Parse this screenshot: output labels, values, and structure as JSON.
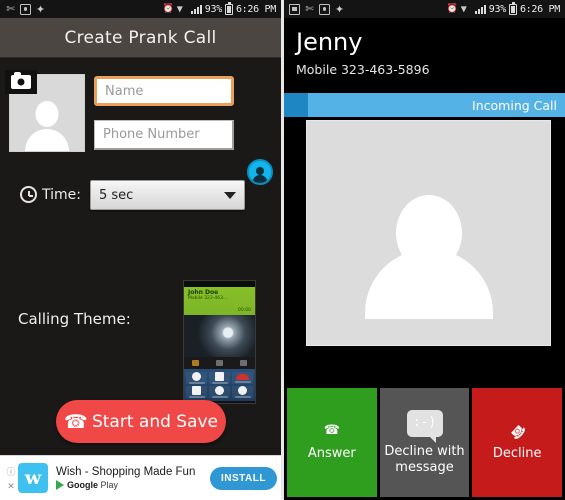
{
  "left": {
    "statusbar": {
      "icons": [
        "scissors-icon",
        "camera-icon",
        "dropbox-icon"
      ],
      "alarm_icon": "alarm-icon",
      "wifi_icon": "wifi-icon",
      "signal_icon": "signal-bars-icon",
      "battery_percent": "93%",
      "battery_icon": "battery-icon",
      "clock": "6:26 PM"
    },
    "title": "Create Prank Call",
    "avatar": {
      "placeholder_icon": "person-silhouette-icon",
      "camera_badge_icon": "camera-icon"
    },
    "fields": {
      "name_placeholder": "Name",
      "name_value": "",
      "phone_placeholder": "Phone Number",
      "phone_value": ""
    },
    "contact_picker_icon": "contact-person-icon",
    "time": {
      "icon": "alarm-clock-icon",
      "label": "Time:",
      "selected": "5 sec",
      "caret_icon": "chevron-down-icon"
    },
    "theme": {
      "label": "Calling Theme:",
      "preview": {
        "caller_name": "John Doe",
        "caller_sub": "Mobile 323-463...",
        "caller_time": "00:00",
        "buttons": [
          "Add Call",
          "Keypad",
          "End Call",
          "Speaker",
          "Mute",
          "Bluetooth"
        ]
      }
    },
    "start_button": {
      "label": "Start and Save",
      "icon": "phone-handset-icon",
      "color": "#f04747"
    },
    "ad": {
      "info_icon": "info-icon",
      "close_icon": "close-icon",
      "app_icon_letter": "w",
      "title": "Wish - Shopping Made Fun",
      "store_prefix": "Google",
      "store_suffix": "Play",
      "store_icon": "google-play-icon",
      "install_label": "INSTALL",
      "install_color": "#2f98d4"
    }
  },
  "right": {
    "statusbar": {
      "icons": [
        "screenshot-icon",
        "scissors-icon",
        "camera-icon",
        "dropbox-icon"
      ],
      "alarm_icon": "alarm-icon",
      "wifi_icon": "wifi-icon",
      "signal_icon": "signal-bars-icon",
      "battery_percent": "93%",
      "battery_icon": "battery-icon",
      "clock": "6:26 PM"
    },
    "caller_name": "Jenny",
    "caller_number": "Mobile 323-463-5896",
    "incoming_label": "Incoming Call",
    "incoming_color": "#55b2e6",
    "photo_icon": "person-silhouette-icon",
    "actions": [
      {
        "label": "Answer",
        "icon": "phone-handset-icon",
        "color": "#2f9e1e"
      },
      {
        "label": "Decline with message",
        "icon": "message-bubble-icon",
        "color": "#555555",
        "bubble_text": ":-)"
      },
      {
        "label": "Decline",
        "icon": "phone-hangup-icon",
        "color": "#c61b1b"
      }
    ]
  }
}
